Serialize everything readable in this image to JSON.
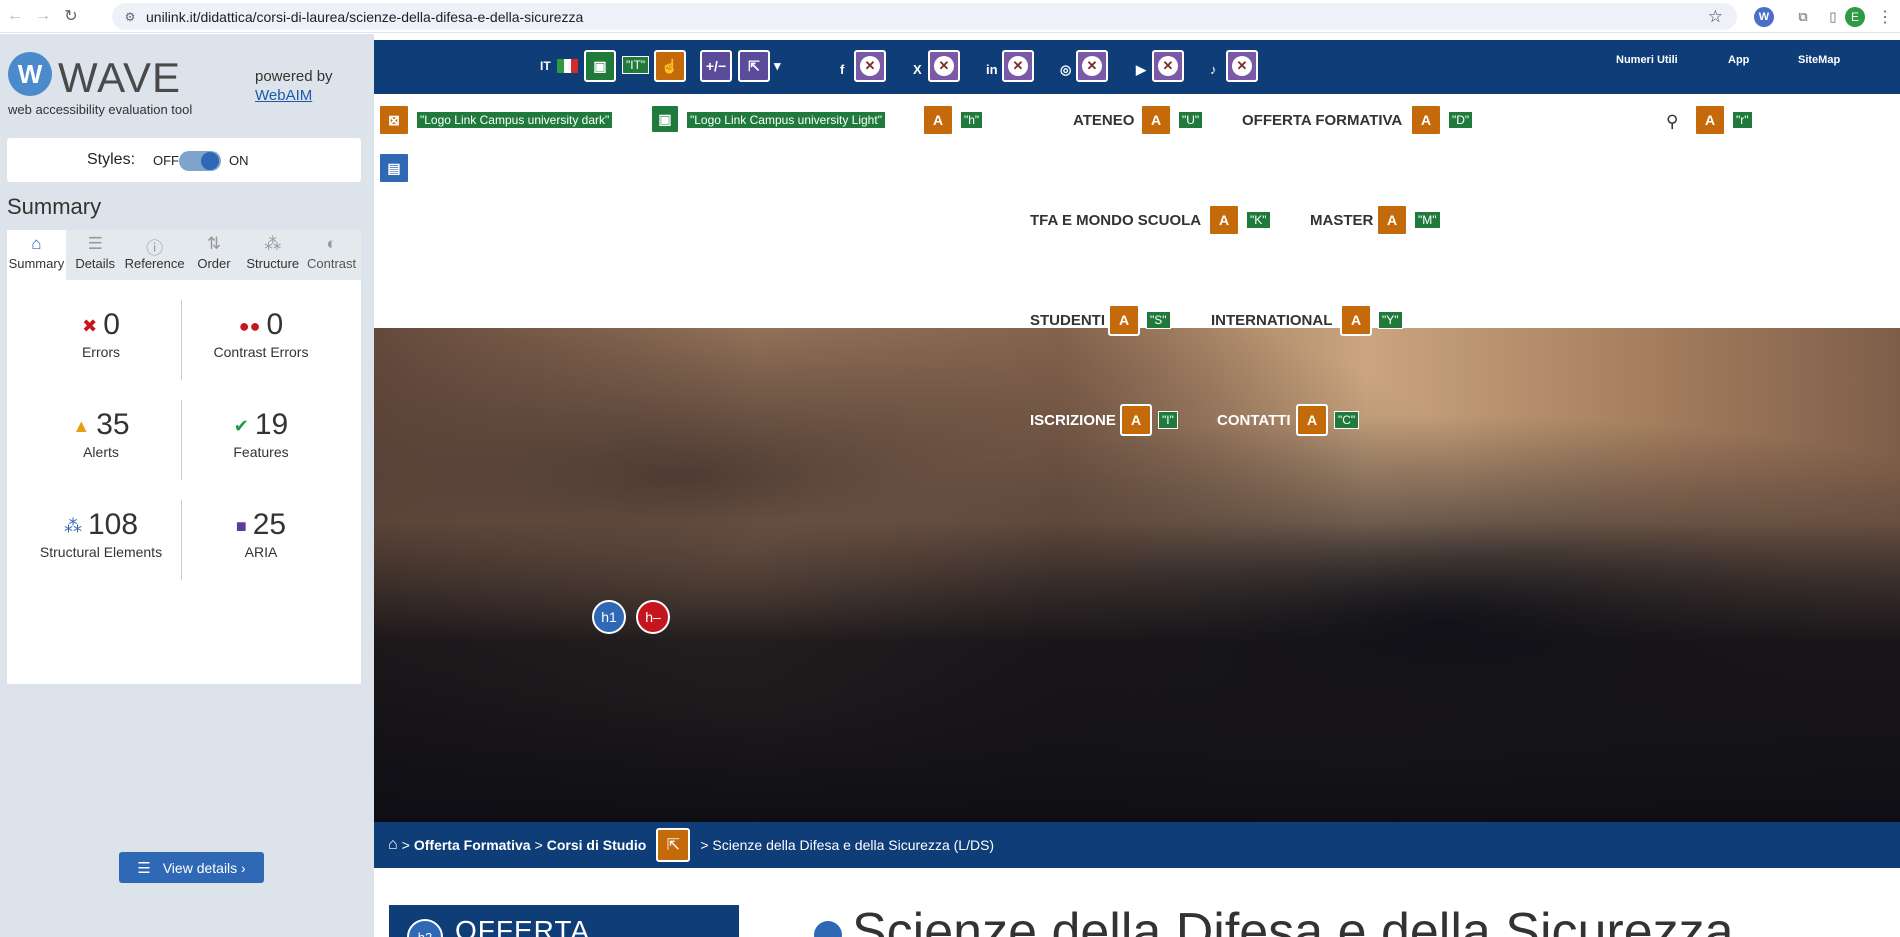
{
  "browser": {
    "url": "unilink.it/didattica/corsi-di-laurea/scienze-della-difesa-e-della-sicurezza",
    "profile_initial": "E"
  },
  "wave": {
    "title": "WAVE",
    "subtitle": "web accessibility evaluation tool",
    "powered_by": "powered by",
    "webaim": "WebAIM",
    "styles_label": "Styles:",
    "styles_off": "OFF",
    "styles_on": "ON",
    "summary_heading": "Summary",
    "tabs": [
      {
        "label": "Summary",
        "icon": "home-icon"
      },
      {
        "label": "Details",
        "icon": "list-icon"
      },
      {
        "label": "Reference",
        "icon": "info-icon"
      },
      {
        "label": "Order",
        "icon": "order-icon"
      },
      {
        "label": "Structure",
        "icon": "structure-icon"
      },
      {
        "label": "Contrast",
        "icon": "contrast-icon"
      }
    ],
    "stats": {
      "errors": {
        "value": "0",
        "label": "Errors"
      },
      "contrast": {
        "value": "0",
        "label": "Contrast Errors"
      },
      "alerts": {
        "value": "35",
        "label": "Alerts"
      },
      "features": {
        "value": "19",
        "label": "Features"
      },
      "structural": {
        "value": "108",
        "label": "Structural Elements"
      },
      "aria": {
        "value": "25",
        "label": "ARIA"
      }
    },
    "view_details": "View details ›"
  },
  "site": {
    "lang": "IT",
    "lang_tag": "\"IT\"",
    "logo_dark": "\"Logo Link Campus university dark\"",
    "logo_light": "\"Logo Link Campus university Light\"",
    "h_tag": "\"h\"",
    "top_links": [
      "Numeri Utili",
      "App",
      "SiteMap"
    ],
    "nav": [
      {
        "label": "ATENEO",
        "tag": "\"U\""
      },
      {
        "label": "OFFERTA FORMATIVA",
        "tag": "\"D\""
      },
      {
        "label": "TFA E MONDO SCUOLA",
        "tag": "\"K\""
      },
      {
        "label": "MASTER",
        "tag": "\"M\""
      },
      {
        "label": "STUDENTI",
        "tag": "\"S\""
      },
      {
        "label": "INTERNATIONAL",
        "tag": "\"Y\""
      },
      {
        "label": "ISCRIZIONE",
        "tag": "\"I\""
      },
      {
        "label": "CONTATTI",
        "tag": "\"C\""
      }
    ],
    "search_tag": "\"r\"",
    "breadcrumb": {
      "items": [
        "Offerta Formativa",
        "Corsi di Studio"
      ],
      "current": "> Scienze della Difesa e della Sicurezza (L/DS)"
    },
    "offerta_box": "OFFERTA",
    "page_title": "Scienze della Difesa e della Sicurezza"
  },
  "colors": {
    "navy": "#0e3d78",
    "wave_blue": "#2f68b5",
    "alert_orange": "#c46a0b",
    "feature_green": "#1f7a3c"
  }
}
